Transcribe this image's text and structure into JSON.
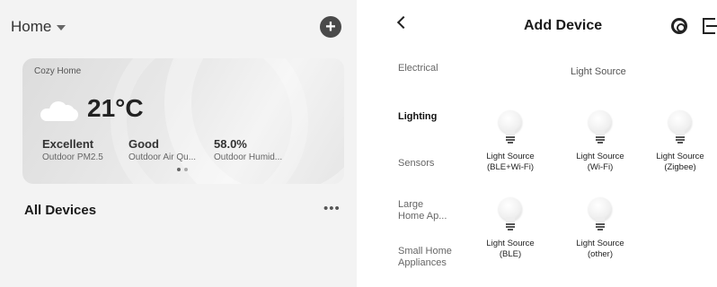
{
  "left": {
    "home_label": "Home",
    "add_icon": "plus-circle-icon",
    "card": {
      "home_name": "Cozy Home",
      "weather_icon": "cloud-icon",
      "temperature": "21°C",
      "stats": [
        {
          "value": "Excellent",
          "label": "Outdoor PM2.5"
        },
        {
          "value": "Good",
          "label": "Outdoor Air Qu..."
        },
        {
          "value": "58.0%",
          "label": "Outdoor Humid..."
        }
      ]
    },
    "all_devices": "All Devices",
    "more": "•••"
  },
  "right": {
    "title": "Add Device",
    "categories": [
      "Electrical",
      "Lighting",
      "Sensors",
      "Large\nHome Ap...",
      "Small Home\nAppliances"
    ],
    "active_category": "Lighting",
    "section_title": "Light Source",
    "devices": [
      {
        "name": "Light Source\n(BLE+Wi-Fi)"
      },
      {
        "name": "Light Source\n(Wi-Fi)"
      },
      {
        "name": "Light Source\n(Zigbee)"
      },
      {
        "name": "Light Source\n(BLE)"
      },
      {
        "name": "Light Source\n(other)"
      }
    ]
  },
  "colors": {
    "background_left": "#f3f3f3",
    "card_gradient_start": "#dcdcdc",
    "text_primary": "#1a1a1a",
    "text_secondary": "#666666"
  }
}
